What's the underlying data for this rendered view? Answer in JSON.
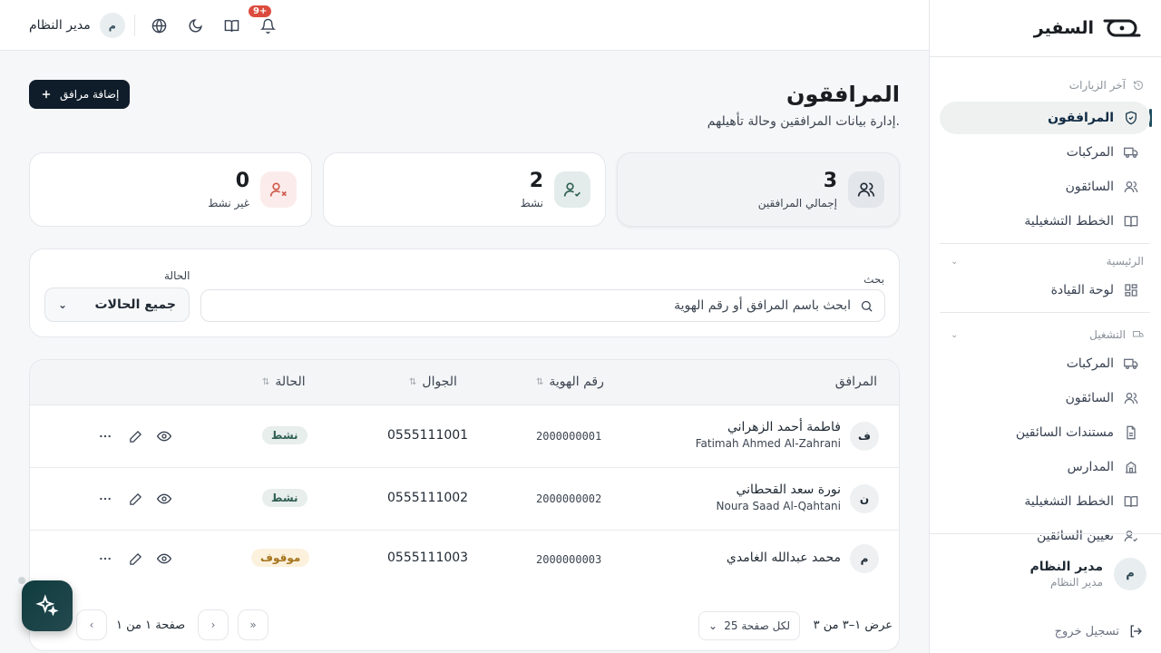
{
  "app": {
    "name": "السفير"
  },
  "topbar": {
    "user_name": "مدير النظام",
    "user_initial": "م",
    "notifications_badge": "9+",
    "icons": [
      "globe-icon",
      "moon-icon",
      "book-open-icon",
      "bell-icon"
    ]
  },
  "sidebar": {
    "recent_heading": "آخر الزيارات",
    "recent_items": [
      {
        "label": "المرافقون",
        "icon": "shield-check-icon",
        "active": true
      },
      {
        "label": "المركبات",
        "icon": "truck-icon"
      },
      {
        "label": "السائقون",
        "icon": "users-icon"
      },
      {
        "label": "الخطط التشغيلية",
        "icon": "book-open-icon"
      }
    ],
    "main_heading": "الرئيسية",
    "main_items": [
      {
        "label": "لوحة القيادة",
        "icon": "dashboard-icon"
      }
    ],
    "ops_heading": "التشغيل",
    "ops_items": [
      {
        "label": "المركبات",
        "icon": "truck-icon"
      },
      {
        "label": "السائقون",
        "icon": "users-icon"
      },
      {
        "label": "مستندات السائقين",
        "icon": "file-text-icon"
      },
      {
        "label": "المدارس",
        "icon": "school-icon"
      },
      {
        "label": "الخطط التشغيلية",
        "icon": "book-open-icon"
      },
      {
        "label": "تعيين السائقين",
        "icon": "user-check-icon"
      }
    ],
    "user": {
      "name": "مدير النظام",
      "role": "مدير النظام",
      "initial": "م"
    },
    "logout_label": "تسجيل خروج"
  },
  "page": {
    "title": "المرافقون",
    "subtitle": "إدارة بيانات المرافقين وحالة تأهيلهم.",
    "add_button_label": "إضافة مرافق"
  },
  "stats": [
    {
      "value": "3",
      "label": "إجمالي المرافقين",
      "icon": "users-icon",
      "color": "#e3e6ea"
    },
    {
      "value": "2",
      "label": "نشط",
      "icon": "user-check-icon",
      "color": "#e3ecea"
    },
    {
      "value": "0",
      "label": "غير نشط",
      "icon": "user-x-icon",
      "color": "#fbeceb"
    }
  ],
  "filters": {
    "search_label": "بحث",
    "search_placeholder": "ابحث باسم المرافق أو رقم الهوية",
    "status_label": "الحالة",
    "status_value": "جميع الحالات"
  },
  "table": {
    "columns": [
      "المرافق",
      "رقم الهوية",
      "الجوال",
      "الحالة"
    ],
    "rows": [
      {
        "initial": "ف",
        "name_ar": "فاطمة أحمد الزهراني",
        "name_en": "Fatimah Ahmed Al-Zahrani",
        "id": "2000000001",
        "phone": "0555111001",
        "status": "نشط",
        "status_kind": "active"
      },
      {
        "initial": "ن",
        "name_ar": "نورة سعد القحطاني",
        "name_en": "Noura Saad Al-Qahtani",
        "id": "2000000002",
        "phone": "0555111002",
        "status": "نشط",
        "status_kind": "active"
      },
      {
        "initial": "م",
        "name_ar": "محمد عبدالله الغامدي",
        "name_en": "",
        "id": "2000000003",
        "phone": "0555111003",
        "status": "موقوف",
        "status_kind": "stopped"
      }
    ]
  },
  "pagination": {
    "showing": "عرض ١–٣ من ٣",
    "per_page": "لكل صفحة 25",
    "page_info": "صفحة ١ من ١"
  },
  "colors": {
    "brand_dark": "#0f1d2b",
    "accent": "#1f4e5f",
    "active_badge": "#2f5f52",
    "stopped_badge": "#a5731a",
    "notification": "#dc4c3e"
  }
}
